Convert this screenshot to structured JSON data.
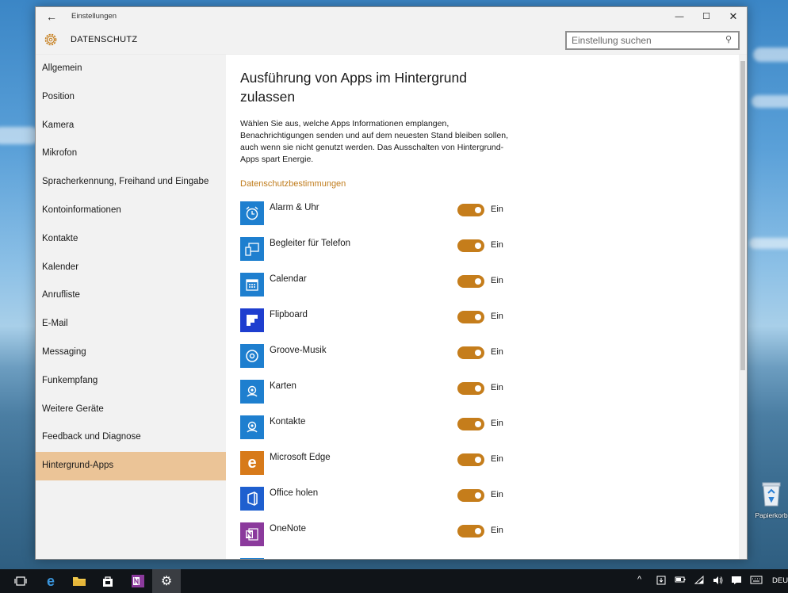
{
  "window": {
    "title": "Einstellungen",
    "header_title": "DATENSCHUTZ",
    "search_placeholder": "Einstellung suchen"
  },
  "sidebar": {
    "items": [
      {
        "label": "Allgemein"
      },
      {
        "label": "Position"
      },
      {
        "label": "Kamera"
      },
      {
        "label": "Mikrofon"
      },
      {
        "label": "Spracherkennung, Freihand und Eingabe"
      },
      {
        "label": "Kontoinformationen"
      },
      {
        "label": "Kontakte"
      },
      {
        "label": "Kalender"
      },
      {
        "label": "Anrufliste"
      },
      {
        "label": "E-Mail"
      },
      {
        "label": "Messaging"
      },
      {
        "label": "Funkempfang"
      },
      {
        "label": "Weitere Geräte"
      },
      {
        "label": "Feedback und Diagnose"
      },
      {
        "label": "Hintergrund-Apps"
      }
    ],
    "active_index": 14
  },
  "main": {
    "title": "Ausführung von Apps im Hintergrund zulassen",
    "description": "Wählen Sie aus, welche Apps Informationen emplangen, Benachrichtigungen senden und auf dem neuesten Stand bleiben sollen, auch wenn sie nicht genutzt werden. Das Ausschalten von Hintergrund-Apps spart Energie.",
    "privacy_link": "Datenschutzbestimmungen",
    "apps": [
      {
        "name": "Alarm & Uhr",
        "state": "Ein",
        "icon": "alarm-clock-icon",
        "color": "#1e7fcf"
      },
      {
        "name": "Begleiter für Telefon",
        "state": "Ein",
        "icon": "phone-companion-icon",
        "color": "#1e7fcf"
      },
      {
        "name": "Calendar",
        "state": "Ein",
        "icon": "calendar-icon",
        "color": "#1e7fcf"
      },
      {
        "name": "Flipboard",
        "state": "Ein",
        "icon": "flipboard-icon",
        "color": "#1e3ecf"
      },
      {
        "name": "Groove-Musik",
        "state": "Ein",
        "icon": "groove-music-icon",
        "color": "#1e7fcf"
      },
      {
        "name": "Karten",
        "state": "Ein",
        "icon": "maps-icon",
        "color": "#1e7fcf"
      },
      {
        "name": "Kontakte",
        "state": "Ein",
        "icon": "contacts-icon",
        "color": "#1e7fcf"
      },
      {
        "name": "Microsoft Edge",
        "state": "Ein",
        "icon": "edge-icon",
        "color": "#d77a1a"
      },
      {
        "name": "Office holen",
        "state": "Ein",
        "icon": "office-icon",
        "color": "#1e5fcf"
      },
      {
        "name": "OneNote",
        "state": "Ein",
        "icon": "onenote-icon",
        "color": "#8b3a9c"
      }
    ]
  },
  "taskbar": {
    "language": "DEU"
  },
  "desktop": {
    "recycle_bin_label": "Papierkorb"
  },
  "colors": {
    "accent": "#c57d1b",
    "selected_nav": "#ebc497",
    "link": "#c07c1c"
  }
}
